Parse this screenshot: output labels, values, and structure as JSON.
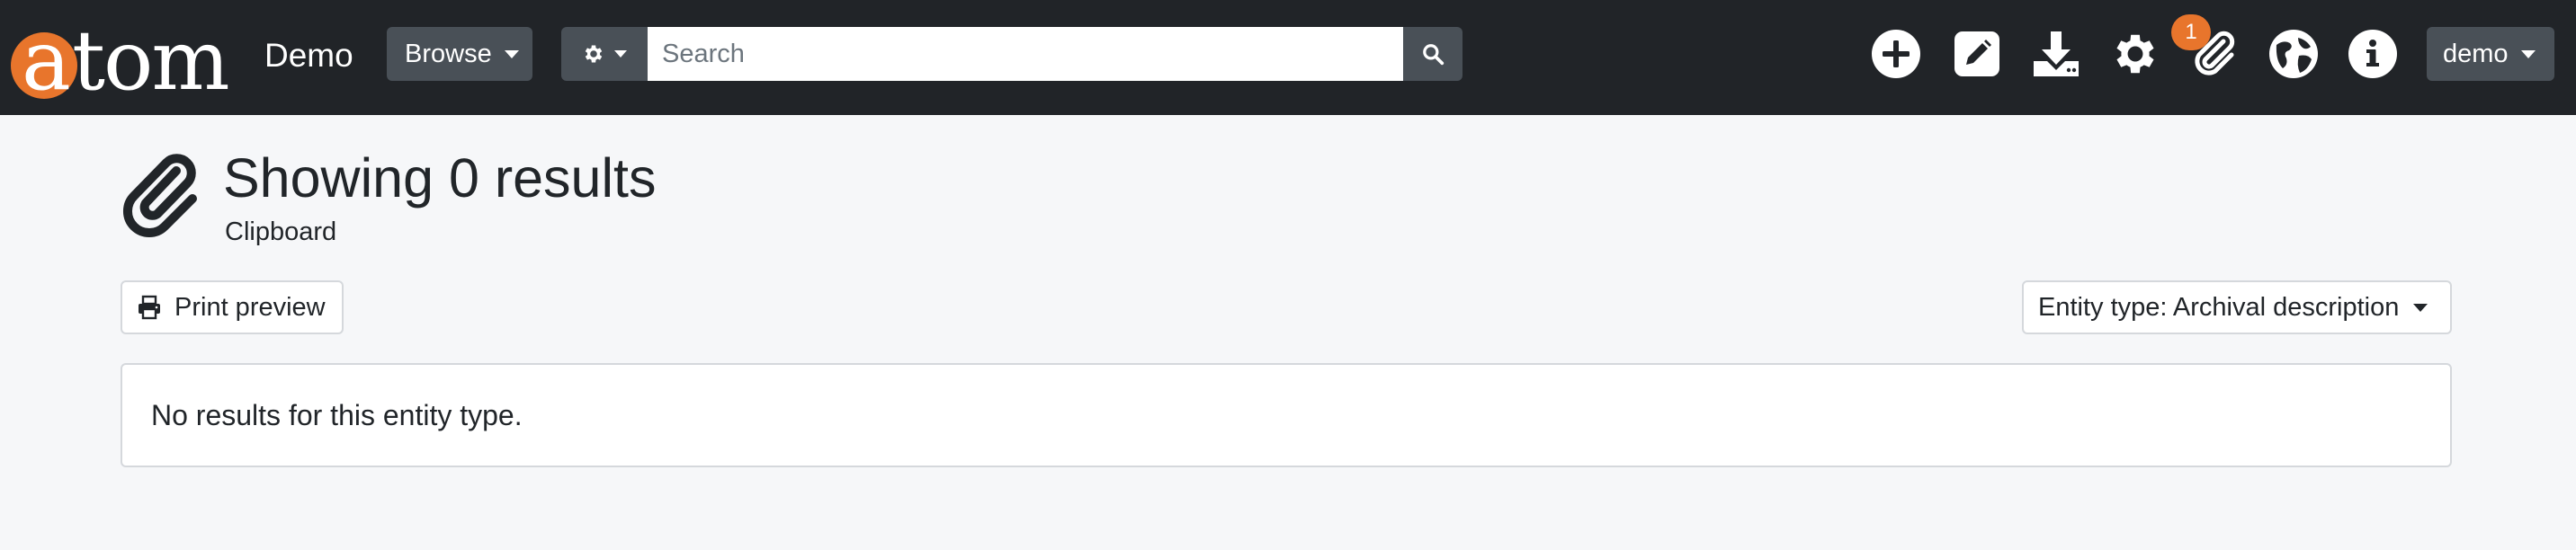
{
  "header": {
    "logo": {
      "letter_a": "a",
      "rest": "tom"
    },
    "site_name": "Demo",
    "browse_label": "Browse",
    "search": {
      "placeholder": "Search",
      "value": ""
    },
    "icons": [
      "plus-icon",
      "edit-icon",
      "download-icon",
      "settings-icon",
      "clipboard-icon",
      "language-icon",
      "info-icon"
    ],
    "clipboard_count": "1",
    "user_label": "demo"
  },
  "main": {
    "title": "Showing 0 results",
    "subtitle": "Clipboard",
    "print_preview_label": "Print preview",
    "entity_type_label": "Entity type: Archival description",
    "empty_message": "No results for this entity type."
  },
  "colors": {
    "navbar_bg": "#212428",
    "button_bg": "#495057",
    "accent": "#e8752c",
    "page_bg": "#f6f7f9"
  }
}
